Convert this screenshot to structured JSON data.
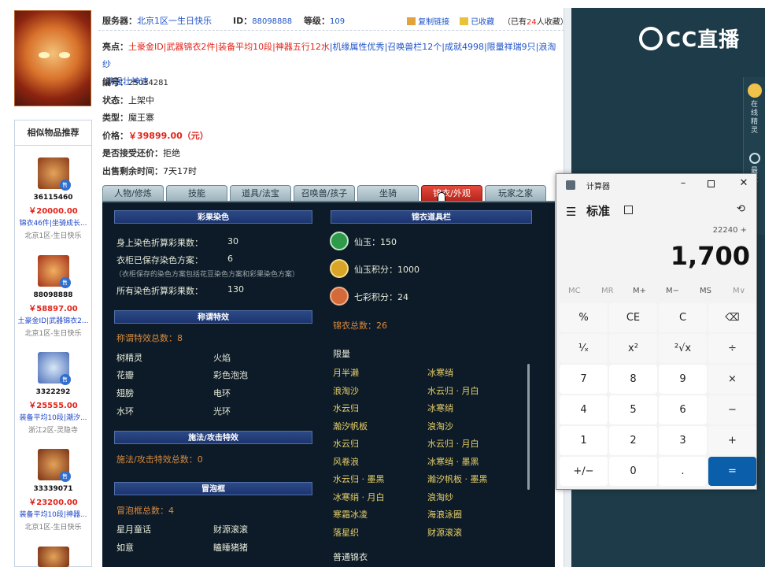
{
  "header": {
    "server_label": "服务器：",
    "server_value": "北京1区一生日快乐",
    "id_label": "ID：",
    "id_value": "88098888",
    "level_label": "等级：",
    "level_value": "109",
    "copy_link": "复制链接",
    "favorited": "已收藏",
    "fav_count_prefix": "（已有",
    "fav_count": "24",
    "fav_count_suffix": "人收藏）"
  },
  "item": {
    "highlight_label": "亮点：",
    "highlight_parts": [
      "土豪金ID",
      "|武器锦衣2件",
      "|装备平均10段",
      "|神器五行12水",
      "|机缘属性优秀",
      "|召唤兽栏12个",
      "|成就4998",
      "|限量祥瑞9只",
      "|浪淘纱",
      "|满强壮神速"
    ],
    "number_label": "编号：",
    "number_value": "25034281",
    "status_label": "状态：",
    "status_value": "上架中",
    "type_label": "类型：",
    "type_value": "魔王寨",
    "price_label": "价格：",
    "price_value": "￥39899.00（元）",
    "bargain_label": "是否接受还价：",
    "bargain_value": "拒绝",
    "time_label": "出售剩余时间：",
    "time_value": "7天17时"
  },
  "similar": {
    "title": "相似物品推荐",
    "tag": "售",
    "items": [
      {
        "id": "36115460",
        "price": "￥20000.00",
        "desc": "锦衣46件|坐骑成长...",
        "server": "北京1区-生日快乐"
      },
      {
        "id": "88098888",
        "price": "￥58897.00",
        "desc": "土豪金ID|武器锦衣2...",
        "server": "北京1区-生日快乐"
      },
      {
        "id": "3322292",
        "price": "￥25555.00",
        "desc": "装备平均10段|潮汐...",
        "server": "浙江2区-灵隐寺"
      },
      {
        "id": "33339071",
        "price": "￥23200.00",
        "desc": "装备平均10段|神器...",
        "server": "北京1区-生日快乐"
      }
    ]
  },
  "tabs": [
    "人物/修炼",
    "技能",
    "道具/法宝",
    "召唤兽/孩子",
    "坐骑",
    "锦衣/外观",
    "玩家之家"
  ],
  "panel": {
    "dye_title": "彩果染色",
    "dye_rows": [
      {
        "label": "身上染色折算彩果数：",
        "value": "30"
      },
      {
        "label": "衣柜已保存染色方案：",
        "value": "6"
      },
      {
        "label": "所有染色折算彩果数：",
        "value": "130"
      }
    ],
    "dye_note": "（衣柜保存的染色方案包括花豆染色方案和彩果染色方案）",
    "title_effect_title": "称谓特效",
    "title_effect_total": "称谓特效总数：8",
    "title_effects": [
      "树精灵",
      "火焰",
      "花瓣",
      "彩色泡泡",
      "翅膀",
      "电环",
      "水环",
      "光环"
    ],
    "spell_title": "施法/攻击特效",
    "spell_total": "施法/攻击特效总数：0",
    "bubble_title": "冒泡框",
    "bubble_total": "冒泡框总数：4",
    "bubbles": [
      "星月童话",
      "财源滚滚",
      "如意",
      "瞌睡猪猪"
    ],
    "wardrobe_title": "锦衣道具栏",
    "currencies": [
      {
        "label": "仙玉：150",
        "icon": "jade-icon",
        "color": "#2f9a4a"
      },
      {
        "label": "仙玉积分：1000",
        "icon": "jade-points-icon",
        "color": "#d8a528"
      },
      {
        "label": "七彩积分：24",
        "icon": "rainbow-points-icon",
        "color": "#d46a3a"
      }
    ],
    "wardrobe_total": "锦衣总数：26",
    "limited_label": "限量",
    "limited_items": [
      "月半濑",
      "冰寒绡",
      "浪淘沙",
      "水云归 · 月白",
      "水云归",
      "冰寒绡",
      "瀚汐帆板",
      "浪淘沙",
      "水云归",
      "水云归 · 月白",
      "风卷浪",
      "冰寒绡 · 墨黑",
      "水云归 · 墨黑",
      "瀚汐帆板 · 墨黑",
      "冰寒绡 · 月白",
      "浪淘纱",
      "寒霜冰凌",
      "海浪泳圈",
      "落星织",
      "财源滚滚"
    ],
    "normal_label": "普通锦衣"
  },
  "stream": {
    "logo": "CC直播",
    "side_items": [
      "在线精灵",
      "最近"
    ]
  },
  "calculator": {
    "title": "计算器",
    "mode": "标准",
    "expression": "22240 +",
    "display": "1,700",
    "memory": [
      "MC",
      "MR",
      "M+",
      "M−",
      "MS",
      "M∨"
    ],
    "keys": [
      [
        "%",
        "CE",
        "C",
        "⌫"
      ],
      [
        "¹⁄ₓ",
        "x²",
        "²√x",
        "÷"
      ],
      [
        "7",
        "8",
        "9",
        "×"
      ],
      [
        "4",
        "5",
        "6",
        "−"
      ],
      [
        "1",
        "2",
        "3",
        "+"
      ],
      [
        "+∕−",
        "0",
        ".",
        "="
      ]
    ]
  }
}
